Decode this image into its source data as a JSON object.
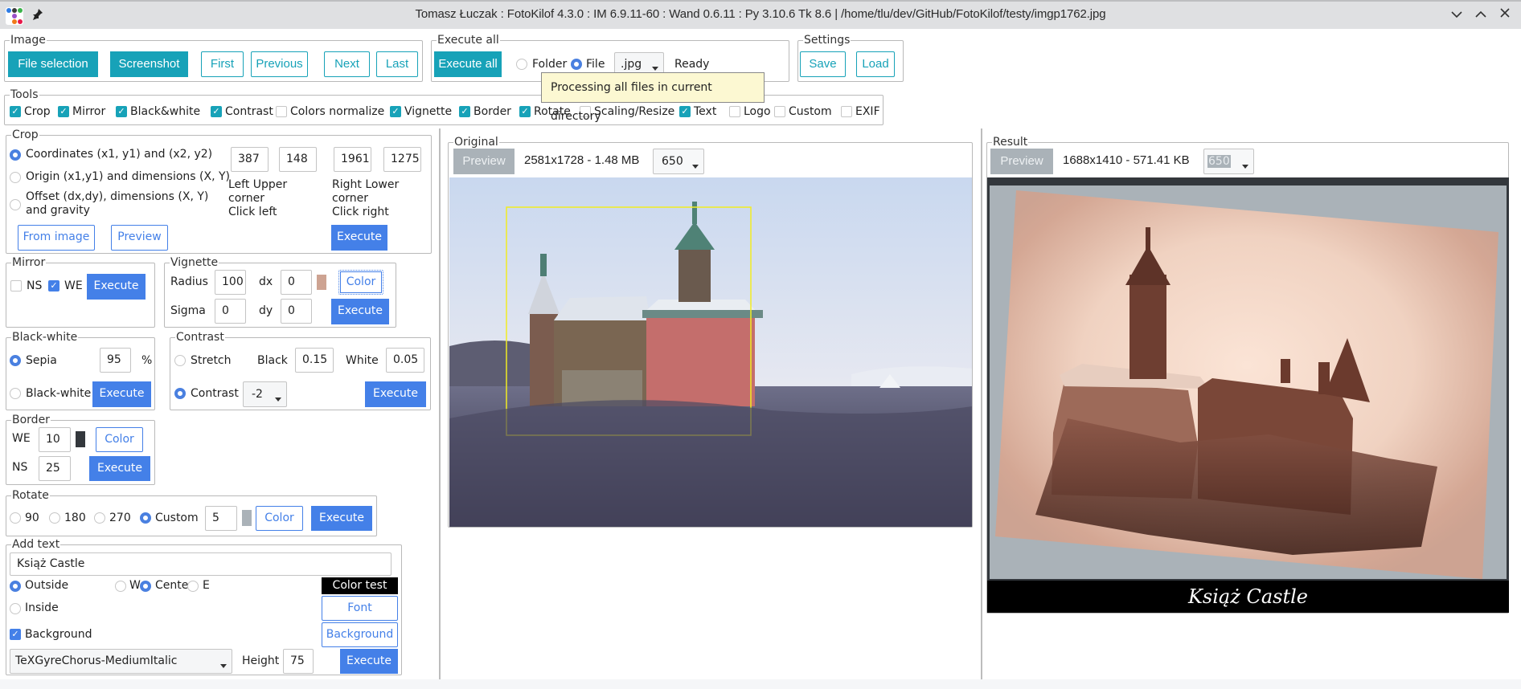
{
  "window": {
    "title": "Tomasz Łuczak : FotoKilof 4.3.0 : IM 6.9.11-60 : Wand 0.6.11 : Py 3.10.6 Tk 8.6 | /home/tlu/dev/GitHub/FotoKilof/testy/imgp1762.jpg",
    "controls": {
      "minimize": "⌄",
      "maximize": "⌃",
      "close": "✕"
    },
    "pin_icon": "📌"
  },
  "image_frame": {
    "legend": "Image",
    "buttons": {
      "file_selection": "File selection",
      "screenshot": "Screenshot",
      "first": "First",
      "previous": "Previous",
      "next": "Next",
      "last": "Last"
    }
  },
  "execute_all": {
    "legend": "Execute all",
    "button": "Execute all",
    "folder_label": "Folder",
    "file_label": "File",
    "selected_scope": "File",
    "extension": ".jpg",
    "status": "Ready",
    "tooltip": "Processing all files in current directory"
  },
  "settings": {
    "legend": "Settings",
    "save": "Save",
    "load": "Load"
  },
  "tools": {
    "legend": "Tools",
    "items": [
      {
        "label": "Crop",
        "checked": true
      },
      {
        "label": "Mirror",
        "checked": true
      },
      {
        "label": "Black&white",
        "checked": true
      },
      {
        "label": "Contrast",
        "checked": true
      },
      {
        "label": "Colors normalize",
        "checked": false
      },
      {
        "label": "Vignette",
        "checked": true
      },
      {
        "label": "Border",
        "checked": true
      },
      {
        "label": "Rotate",
        "checked": true
      },
      {
        "label": "Scaling/Resize",
        "checked": false
      },
      {
        "label": "Text",
        "checked": true
      },
      {
        "label": "Logo",
        "checked": false
      },
      {
        "label": "Custom",
        "checked": false
      },
      {
        "label": "EXIF",
        "checked": false
      }
    ]
  },
  "crop": {
    "legend": "Crop",
    "options": [
      "Coordinates (x1, y1) and (x2, y2)",
      "Origin (x1,y1) and dimensions (X, Y)",
      "Offset (dx,dy), dimensions (X, Y)",
      "and gravity"
    ],
    "selected_option": 0,
    "x1": "387",
    "y1": "148",
    "x2": "1961",
    "y2": "1275",
    "left_upper": [
      "Left Upper",
      "corner",
      "Click left"
    ],
    "right_lower": [
      "Right Lower",
      "corner",
      "Click right"
    ],
    "from_image": "From image",
    "preview": "Preview",
    "execute": "Execute"
  },
  "mirror": {
    "legend": "Mirror",
    "ns_label": "NS",
    "ns_checked": false,
    "we_label": "WE",
    "we_checked": true,
    "execute": "Execute"
  },
  "vignette": {
    "legend": "Vignette",
    "radius_label": "Radius",
    "radius": "100",
    "dx_label": "dx",
    "dx": "0",
    "sigma_label": "Sigma",
    "sigma": "0",
    "dy_label": "dy",
    "dy": "0",
    "color_swatch": "#cda392",
    "color": "Color",
    "execute": "Execute"
  },
  "black_white": {
    "legend": "Black-white",
    "sepia_label": "Sepia",
    "sepia_value": "95",
    "percent": "%",
    "bw_label": "Black-white",
    "selected": "Sepia",
    "execute": "Execute"
  },
  "contrast": {
    "legend": "Contrast",
    "stretch_label": "Stretch",
    "black_label": "Black",
    "black": "0.15",
    "white_label": "White",
    "white": "0.05",
    "contrast_label": "Contrast",
    "contrast_value": "-2",
    "selected": "Contrast",
    "execute": "Execute"
  },
  "border": {
    "legend": "Border",
    "we_label": "WE",
    "we": "10",
    "ns_label": "NS",
    "ns": "25",
    "color_swatch": "#33373c",
    "color": "Color",
    "execute": "Execute"
  },
  "rotate": {
    "legend": "Rotate",
    "options": [
      "90",
      "180",
      "270",
      "Custom"
    ],
    "selected": "Custom",
    "custom_value": "5",
    "color_swatch": "#aab2b8",
    "color": "Color",
    "execute": "Execute"
  },
  "add_text": {
    "legend": "Add text",
    "text": "Książ Castle",
    "outside_label": "Outside",
    "inside_label": "Inside",
    "placement": "Outside",
    "w_label": "W",
    "center_label": "Center",
    "e_label": "E",
    "alignment": "Center",
    "color_test": "Color test",
    "font_button": "Font",
    "background_checkbox": "Background",
    "background_checked": true,
    "background_button": "Background",
    "font_name": "TeXGyreChorus-MediumItalic",
    "height_label": "Height",
    "height": "75",
    "execute": "Execute"
  },
  "original": {
    "legend": "Original",
    "preview": "Preview",
    "info": "2581x1728 - 1.48 MB",
    "size": "650"
  },
  "result": {
    "legend": "Result",
    "preview": "Preview",
    "info": "1688x1410 - 571.41 KB",
    "size": "650",
    "caption": "Książ Castle"
  }
}
